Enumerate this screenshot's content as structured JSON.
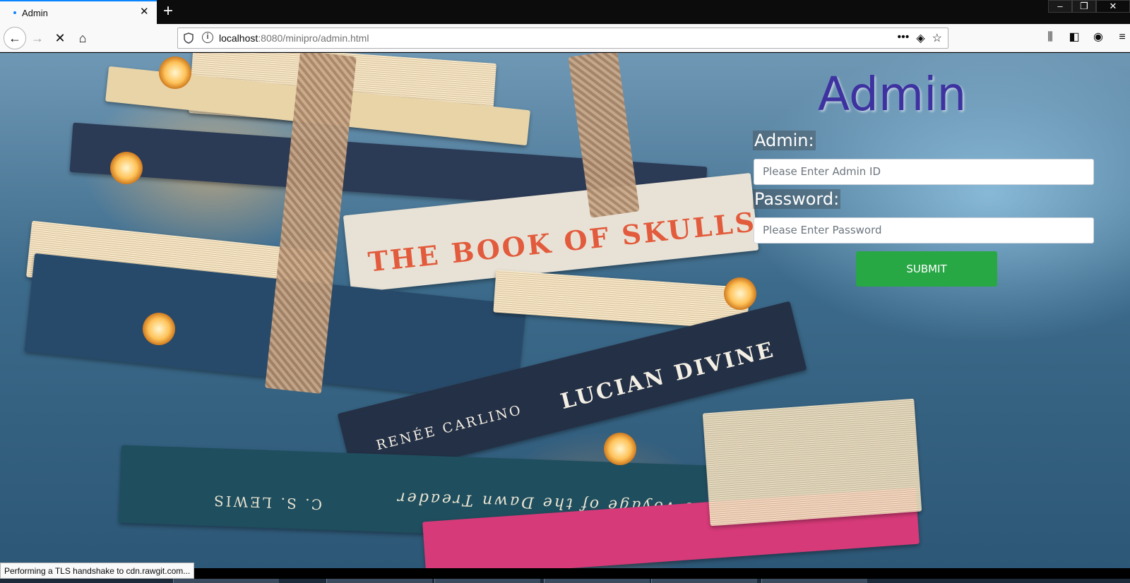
{
  "browser": {
    "tab_title": "Admin",
    "url_host": "localhost",
    "url_path": ":8080/minipro/admin.html",
    "status_text": "Performing a TLS handshake to cdn.rawgit.com..."
  },
  "page": {
    "heading": "Admin",
    "admin_label": "Admin:",
    "admin_placeholder": "Please Enter Admin ID",
    "password_label": "Password:",
    "password_placeholder": "Please Enter Password",
    "submit_label": "SUBMIT"
  },
  "background": {
    "book_title_1": "THE BOOK OF SKULLS",
    "book_title_2": "LUCIAN DIVINE",
    "book_author_2": "RENÉE CARLINO",
    "book_title_3": "The Voyage of the Dawn Treader",
    "book_author_3": "C. S. LEWIS"
  },
  "colors": {
    "heading": "#3d32a0",
    "submit": "#28a745",
    "tab_accent": "#0a84ff"
  }
}
